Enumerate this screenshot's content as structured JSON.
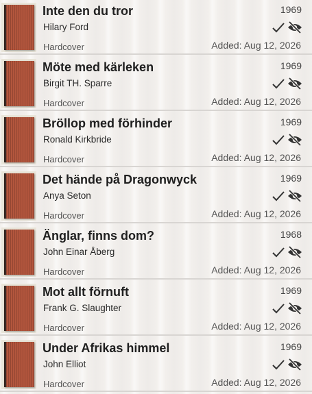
{
  "books": [
    {
      "title": "Inte den du tror",
      "author": "Hilary Ford",
      "format": "Hardcover",
      "year": "1969",
      "added": "Added: Aug 12, 2026"
    },
    {
      "title": "Möte med kärleken",
      "author": "Birgit TH. Sparre",
      "format": "Hardcover",
      "year": "1969",
      "added": "Added: Aug 12, 2026"
    },
    {
      "title": "Bröllop med förhinder",
      "author": "Ronald Kirkbride",
      "format": "Hardcover",
      "year": "1969",
      "added": "Added: Aug 12, 2026"
    },
    {
      "title": "Det hände på Dragonwyck",
      "author": "Anya Seton",
      "format": "Hardcover",
      "year": "1969",
      "added": "Added: Aug 12, 2026"
    },
    {
      "title": "Änglar, finns dom?",
      "author": "John Einar Åberg",
      "format": "Hardcover",
      "year": "1968",
      "added": "Added: Aug 12, 2026"
    },
    {
      "title": "Mot allt förnuft",
      "author": "Frank G. Slaughter",
      "format": "Hardcover",
      "year": "1969",
      "added": "Added: Aug 12, 2026"
    },
    {
      "title": "Under Afrikas himmel",
      "author": "John Elliot",
      "format": "Hardcover",
      "year": "1969",
      "added": "Added: Aug 12, 2026"
    }
  ],
  "icons": {
    "read": "check-icon",
    "hidden": "eye-off-icon"
  },
  "colors": {
    "cover": "#b3563d",
    "text": "#1f1f1f",
    "divider": "#d8d5d2"
  }
}
